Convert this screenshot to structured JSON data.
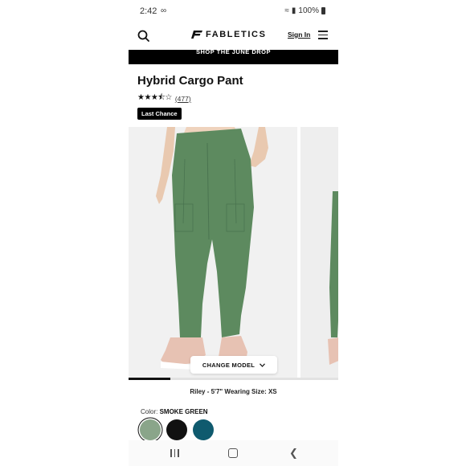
{
  "status_bar": {
    "time": "2:42",
    "battery": "100%"
  },
  "header": {
    "brand": "FABLETICS",
    "sign_in": "Sign In"
  },
  "promo": {
    "text": "SHOP THE JUNE DROP"
  },
  "product": {
    "title": "Hybrid Cargo Pant",
    "rating": 3.5,
    "reviews": "(477)",
    "badge": "Last Chance",
    "change_model": "CHANGE MODEL",
    "model_caption": "Riley - 5'7\" Wearing Size: XS",
    "color_label": "Color:",
    "color_name": "SMOKE GREEN",
    "swatches": [
      {
        "name": "smoke-green",
        "color": "#8aa58a"
      },
      {
        "name": "black",
        "color": "#111111"
      },
      {
        "name": "teal",
        "color": "#0f5a6e"
      }
    ],
    "gallery_progress": 0.2
  },
  "colors": {
    "pant": "#5d8a5f",
    "shoe": "#e7c2b3"
  }
}
